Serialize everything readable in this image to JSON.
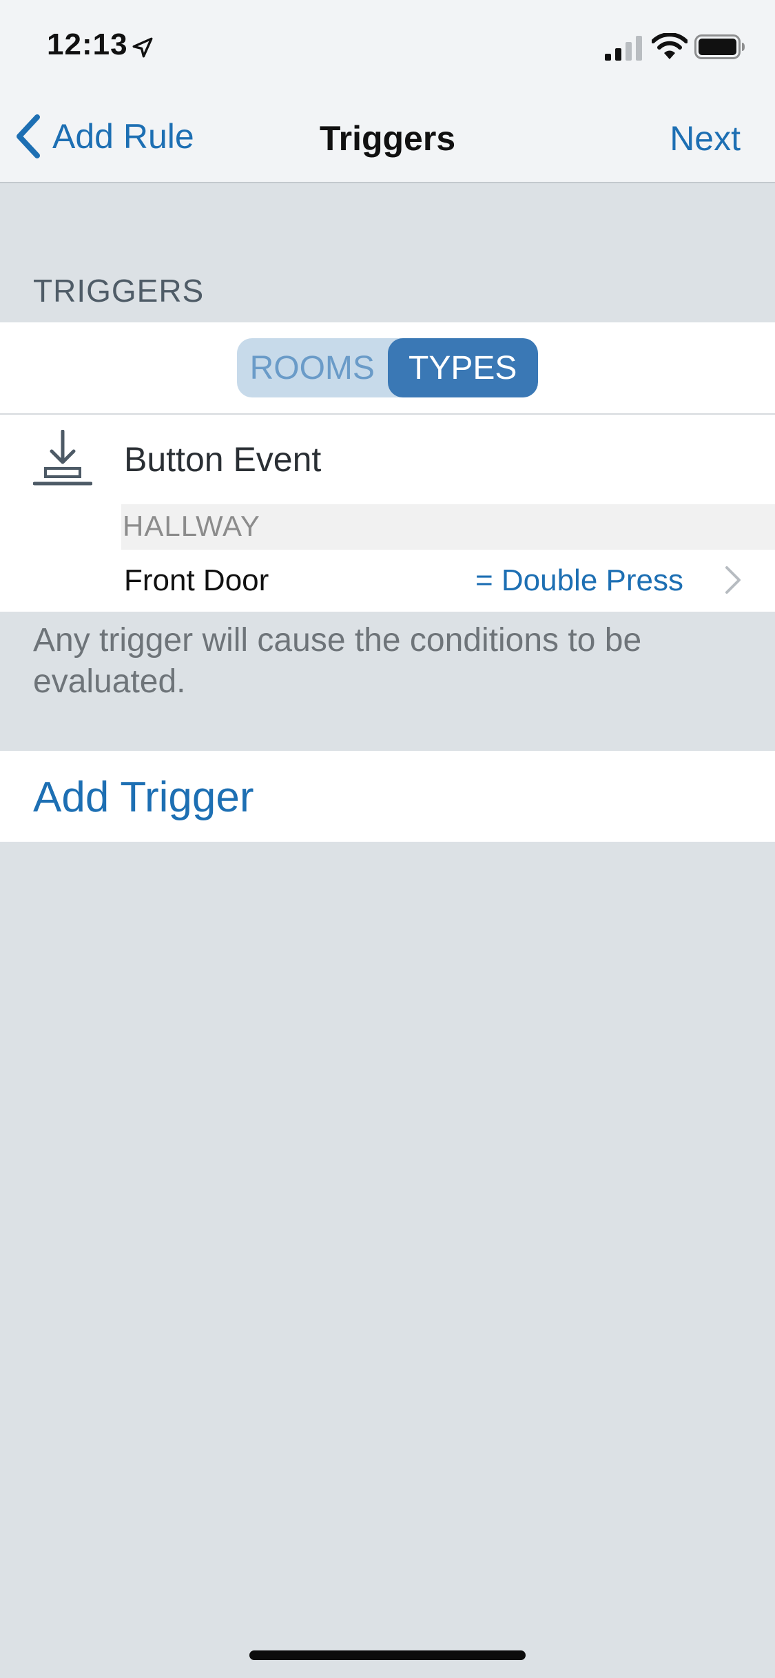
{
  "status_bar": {
    "time": "12:13",
    "location_icon": "location-arrow-icon",
    "signal_icon": "cellular-signal-icon",
    "wifi_icon": "wifi-icon",
    "battery_icon": "battery-icon"
  },
  "nav": {
    "back_label": "Add Rule",
    "back_icon": "chevron-left-icon",
    "title": "Triggers",
    "next_label": "Next"
  },
  "section": {
    "header": "TRIGGERS"
  },
  "segmented": {
    "options": [
      "ROOMS",
      "TYPES"
    ],
    "selected": "TYPES"
  },
  "trigger": {
    "icon": "button-press-icon",
    "title": "Button Event",
    "room": "HALLWAY",
    "device": "Front Door",
    "value": "= Double Press"
  },
  "footer_note": "Any trigger will cause the conditions to be evaluated.",
  "add_trigger_label": "Add Trigger",
  "colors": {
    "accent": "#1d6fb3",
    "segment_selected": "#3a78b5",
    "segment_bg": "#c7daea",
    "background": "#dce1e5"
  }
}
